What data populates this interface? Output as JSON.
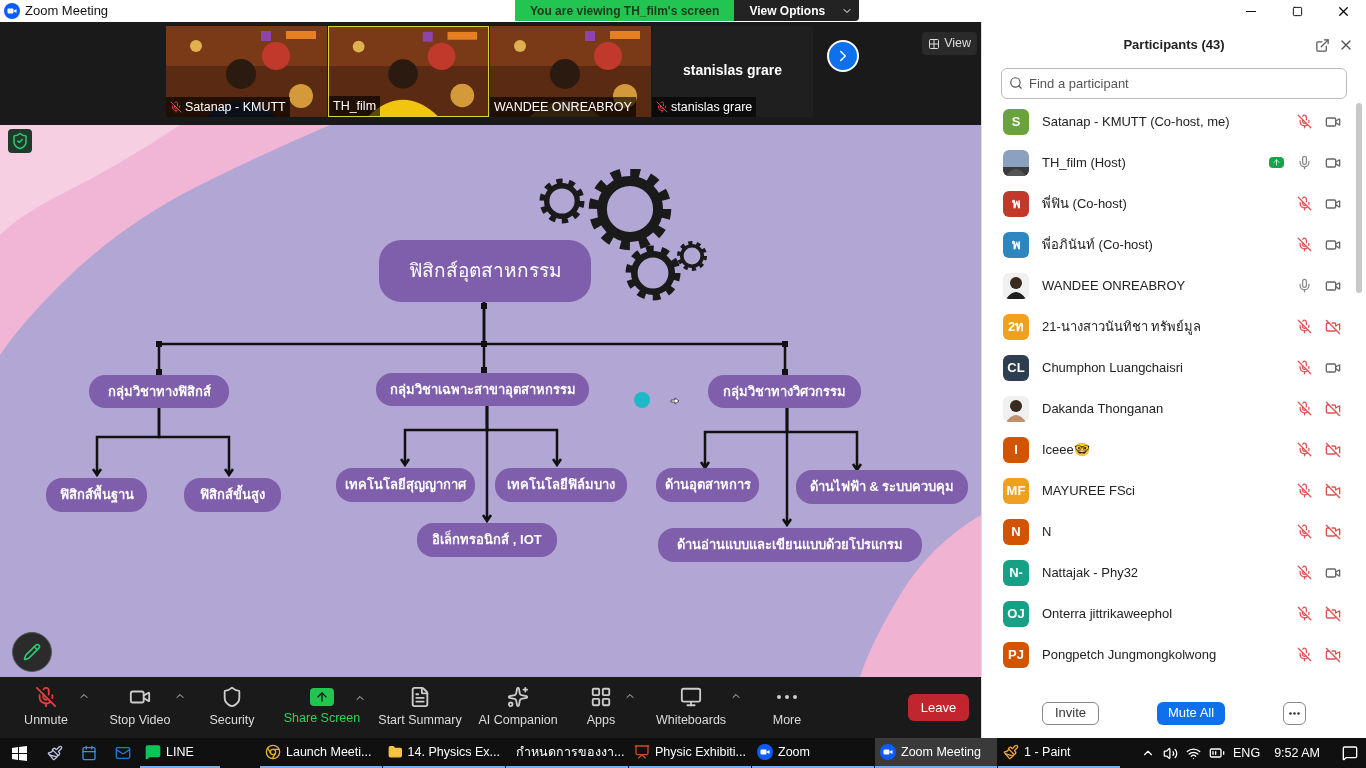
{
  "title_bar": {
    "title": "Zoom Meeting",
    "banner": "You are viewing TH_film's screen",
    "banner_button": "View Options"
  },
  "video_strip": {
    "tiles": [
      {
        "name": "Satanap - KMUTT",
        "kind": "video",
        "muted": true,
        "selected": false
      },
      {
        "name": "TH_film",
        "kind": "video",
        "muted": false,
        "selected": true
      },
      {
        "name": "WANDEE ONREABROY",
        "kind": "video",
        "muted": false,
        "selected": false
      },
      {
        "name": "stanislas grare",
        "kind": "name_only",
        "display_name": "stanislas grare",
        "muted": true,
        "selected": false
      }
    ],
    "view_button": "View"
  },
  "slide": {
    "title": "ฟิสิกส์อุตสาหกรรม",
    "groups": [
      {
        "label": "กลุ่มวิชาทางฟิสิกส์",
        "children": [
          {
            "label": "ฟิสิกส์พื้นฐาน"
          },
          {
            "label": "ฟิสิกส์ขั้นสูง"
          }
        ]
      },
      {
        "label": "กลุ่มวิชาเฉพาะสาขาอุตสาหกรรม",
        "children": [
          {
            "label": "เทคโนโลยีสุญญากาศ"
          },
          {
            "label": "เทคโนโลยีฟิล์มบาง"
          },
          {
            "label": "อิเล็กทรอนิกส์ , IOT"
          }
        ]
      },
      {
        "label": "กลุ่มวิชาทางวิศวกรรม",
        "children": [
          {
            "label": "ด้านอุตสาหการ"
          },
          {
            "label": "ด้านไฟฟ้า & ระบบควบคุม"
          },
          {
            "label": "ด้านอ่านแบบและเขียนแบบด้วยโปรแกรม"
          }
        ]
      }
    ]
  },
  "toolbar": {
    "items": [
      {
        "label": "Unmute",
        "kind": "mic",
        "caret": true,
        "muted": true
      },
      {
        "label": "Stop Video",
        "kind": "video",
        "caret": true
      },
      {
        "label": "Security",
        "kind": "security",
        "caret": false
      },
      {
        "label": "Share Screen",
        "kind": "share",
        "caret": true
      },
      {
        "label": "Start Summary",
        "kind": "summary",
        "caret": false
      },
      {
        "label": "AI Companion",
        "kind": "ai",
        "caret": false
      },
      {
        "label": "Apps",
        "kind": "apps",
        "caret": true
      },
      {
        "label": "Whiteboards",
        "kind": "whiteboard",
        "caret": true
      },
      {
        "label": "More",
        "kind": "more",
        "caret": false
      }
    ],
    "leave": "Leave"
  },
  "participants": {
    "title": "Participants (43)",
    "search": {
      "placeholder": "Find a participant"
    },
    "items": [
      {
        "name": "Satanap - KMUTT (Co-host, me)",
        "kind": "initials",
        "initials": "S",
        "color": "#6aa23c",
        "sharing": false,
        "muted": true,
        "video_off": false
      },
      {
        "name": "TH_film (Host)",
        "kind": "picture",
        "sharing": true,
        "muted": false,
        "video_off": false
      },
      {
        "name": "พี่ฟิน (Co-host)",
        "kind": "initials",
        "initials": "พ",
        "color": "#c0392b",
        "sharing": false,
        "muted": true,
        "video_off": false
      },
      {
        "name": "พี่อภินันท์ (Co-host)",
        "kind": "initials",
        "initials": "พ",
        "color": "#2e86c1",
        "sharing": false,
        "muted": true,
        "video_off": false
      },
      {
        "name": "WANDEE ONREABROY",
        "kind": "picture",
        "sharing": false,
        "muted": false,
        "video_off": false
      },
      {
        "name": "21-นางสาวนันทิชา ทรัพย์มูล",
        "kind": "initials",
        "initials": "2ท",
        "color": "#f0a020",
        "sharing": false,
        "muted": true,
        "video_off": true
      },
      {
        "name": "Chumphon Luangchaisri",
        "kind": "initials",
        "initials": "CL",
        "color": "#2c3e50",
        "sharing": false,
        "muted": true,
        "video_off": false
      },
      {
        "name": "Dakanda Thonganan",
        "kind": "picture",
        "sharing": false,
        "muted": true,
        "video_off": true
      },
      {
        "name": "Iceee🤓",
        "kind": "initials",
        "initials": "I",
        "color": "#d35400",
        "sharing": false,
        "muted": true,
        "video_off": true
      },
      {
        "name": "MAYUREE FSci",
        "kind": "initials",
        "initials": "MF",
        "color": "#f0a020",
        "sharing": false,
        "muted": true,
        "video_off": true
      },
      {
        "name": "N",
        "kind": "initials",
        "initials": "N",
        "color": "#d35400",
        "sharing": false,
        "muted": true,
        "video_off": true
      },
      {
        "name": "Nattajak - Phy32",
        "kind": "initials",
        "initials": "N-",
        "color": "#16a085",
        "sharing": false,
        "muted": true,
        "video_off": false
      },
      {
        "name": "Onterra jittrikaweephol",
        "kind": "initials",
        "initials": "OJ",
        "color": "#16a085",
        "sharing": false,
        "muted": true,
        "video_off": true
      },
      {
        "name": "Pongpetch Jungmongkolwong",
        "kind": "initials",
        "initials": "PJ",
        "color": "#d35400",
        "sharing": false,
        "muted": true,
        "video_off": true
      }
    ],
    "invite": "Invite",
    "mute_all": "Mute All"
  },
  "taskbar": {
    "apps": [
      {
        "label": "LINE",
        "kind": "line",
        "selected": false
      },
      {
        "label": "Launch Meeti...",
        "kind": "chrome",
        "selected": false
      },
      {
        "label": "14. Physics Ex...",
        "kind": "folder",
        "selected": false
      },
      {
        "label": "กำหนดการของงา...",
        "kind": "pdf",
        "selected": false
      },
      {
        "label": "Physic Exhibiti...",
        "kind": "ppt",
        "selected": false
      },
      {
        "label": "Zoom",
        "kind": "zoom",
        "selected": false
      },
      {
        "label": "Zoom Meeting",
        "kind": "zoom",
        "selected": true
      },
      {
        "label": "1 - Paint",
        "kind": "paint",
        "selected": false
      }
    ],
    "language": "ENG",
    "time": "9:52 AM"
  }
}
